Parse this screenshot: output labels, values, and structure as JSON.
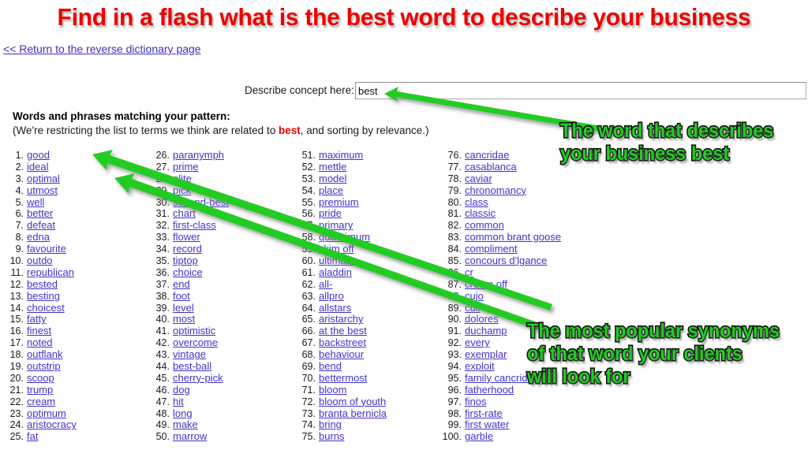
{
  "page": {
    "title": "Find in a flash what is the best word to describe your business",
    "return_link": "<< Return to the reverse dictionary page"
  },
  "form": {
    "label": "Describe concept here:",
    "value": "best",
    "placeholder": ""
  },
  "results": {
    "heading": "Words and phrases matching your pattern:",
    "subheading_before": "(We're restricting the list to terms we think are related to ",
    "subheading_keyword": "best",
    "subheading_after": ", and sorting by relevance.)"
  },
  "annotations": {
    "top": "The word that describes\nyour business best",
    "bottom": "The most popular synonyms\nof that word your clients\nwill look for",
    "color": "#22cc22",
    "outline": "#111111"
  },
  "colors": {
    "title_red": "#ee0000",
    "link_blue": "#4033cc",
    "annotation_green": "#22cc22",
    "keyword_red": "#ee0000"
  },
  "words": [
    {
      "n": "1.",
      "w": "good"
    },
    {
      "n": "2.",
      "w": "ideal"
    },
    {
      "n": "3.",
      "w": "optimal"
    },
    {
      "n": "4.",
      "w": "utmost"
    },
    {
      "n": "5.",
      "w": "well"
    },
    {
      "n": "6.",
      "w": "better"
    },
    {
      "n": "7.",
      "w": "defeat"
    },
    {
      "n": "8.",
      "w": "edna"
    },
    {
      "n": "9.",
      "w": "favourite"
    },
    {
      "n": "10.",
      "w": "outdo"
    },
    {
      "n": "11.",
      "w": "republican"
    },
    {
      "n": "12.",
      "w": "bested"
    },
    {
      "n": "13.",
      "w": "besting"
    },
    {
      "n": "14.",
      "w": "choicest"
    },
    {
      "n": "15.",
      "w": "fatty"
    },
    {
      "n": "16.",
      "w": "finest"
    },
    {
      "n": "17.",
      "w": "noted"
    },
    {
      "n": "18.",
      "w": "outflank"
    },
    {
      "n": "19.",
      "w": "outstrip"
    },
    {
      "n": "20.",
      "w": "scoop"
    },
    {
      "n": "21.",
      "w": "trump"
    },
    {
      "n": "22.",
      "w": "cream"
    },
    {
      "n": "23.",
      "w": "optimum"
    },
    {
      "n": "24.",
      "w": "aristocracy"
    },
    {
      "n": "25.",
      "w": "fat"
    },
    {
      "n": "26.",
      "w": "paranymph"
    },
    {
      "n": "27.",
      "w": "prime"
    },
    {
      "n": "28.",
      "w": "elite"
    },
    {
      "n": "29.",
      "w": "pick"
    },
    {
      "n": "30.",
      "w": "second-best"
    },
    {
      "n": "31.",
      "w": "chart"
    },
    {
      "n": "32.",
      "w": "first-class"
    },
    {
      "n": "33.",
      "w": "flower"
    },
    {
      "n": "34.",
      "w": "record"
    },
    {
      "n": "35.",
      "w": "tiptop"
    },
    {
      "n": "36.",
      "w": "choice"
    },
    {
      "n": "37.",
      "w": "end"
    },
    {
      "n": "38.",
      "w": "foot"
    },
    {
      "n": "39.",
      "w": "level"
    },
    {
      "n": "40.",
      "w": "most"
    },
    {
      "n": "41.",
      "w": "optimistic"
    },
    {
      "n": "42.",
      "w": "overcome"
    },
    {
      "n": "43.",
      "w": "vintage"
    },
    {
      "n": "44.",
      "w": "best-ball"
    },
    {
      "n": "45.",
      "w": "cherry-pick"
    },
    {
      "n": "46.",
      "w": "dog"
    },
    {
      "n": "47.",
      "w": "hit"
    },
    {
      "n": "48.",
      "w": "long"
    },
    {
      "n": "49.",
      "w": "make"
    },
    {
      "n": "50.",
      "w": "marrow"
    },
    {
      "n": "51.",
      "w": "maximum"
    },
    {
      "n": "52.",
      "w": "mettle"
    },
    {
      "n": "53.",
      "w": "model"
    },
    {
      "n": "54.",
      "w": "place"
    },
    {
      "n": "55.",
      "w": "premium"
    },
    {
      "n": "56.",
      "w": "pride"
    },
    {
      "n": "57.",
      "w": "primary"
    },
    {
      "n": "58.",
      "w": "quadrimum"
    },
    {
      "n": "59.",
      "w": "skim off"
    },
    {
      "n": "60.",
      "w": "ultimate"
    },
    {
      "n": "61.",
      "w": "aladdin"
    },
    {
      "n": "62.",
      "w": "all-"
    },
    {
      "n": "63.",
      "w": "allpro"
    },
    {
      "n": "64.",
      "w": "allstars"
    },
    {
      "n": "65.",
      "w": "aristarchy"
    },
    {
      "n": "66.",
      "w": "at the best"
    },
    {
      "n": "67.",
      "w": "backstreet"
    },
    {
      "n": "68.",
      "w": "behaviour"
    },
    {
      "n": "69.",
      "w": "bend"
    },
    {
      "n": "70.",
      "w": "bettermost"
    },
    {
      "n": "71.",
      "w": "bloom"
    },
    {
      "n": "72.",
      "w": "bloom of youth"
    },
    {
      "n": "73.",
      "w": "branta bernicla"
    },
    {
      "n": "74.",
      "w": "bring"
    },
    {
      "n": "75.",
      "w": "burns"
    },
    {
      "n": "76.",
      "w": "cancridae"
    },
    {
      "n": "77.",
      "w": "casablanca"
    },
    {
      "n": "78.",
      "w": "caviar"
    },
    {
      "n": "79.",
      "w": "chronomancy"
    },
    {
      "n": "80.",
      "w": "class"
    },
    {
      "n": "81.",
      "w": "classic"
    },
    {
      "n": "82.",
      "w": "common"
    },
    {
      "n": "83.",
      "w": "common brant goose"
    },
    {
      "n": "84.",
      "w": "compliment"
    },
    {
      "n": "85.",
      "w": "concours d'lgance"
    },
    {
      "n": "86.",
      "w": "cr"
    },
    {
      "n": "87.",
      "w": "cream off"
    },
    {
      "n": "88.",
      "w": "cujo"
    },
    {
      "n": "89.",
      "w": "cull"
    },
    {
      "n": "90.",
      "w": "dolores"
    },
    {
      "n": "91.",
      "w": "duchamp"
    },
    {
      "n": "92.",
      "w": "every"
    },
    {
      "n": "93.",
      "w": "exemplar"
    },
    {
      "n": "94.",
      "w": "exploit"
    },
    {
      "n": "95.",
      "w": "family cancridae"
    },
    {
      "n": "96.",
      "w": "fatherhood"
    },
    {
      "n": "97.",
      "w": "finos"
    },
    {
      "n": "98.",
      "w": "first-rate"
    },
    {
      "n": "99.",
      "w": "first water"
    },
    {
      "n": "100.",
      "w": "garble"
    }
  ]
}
